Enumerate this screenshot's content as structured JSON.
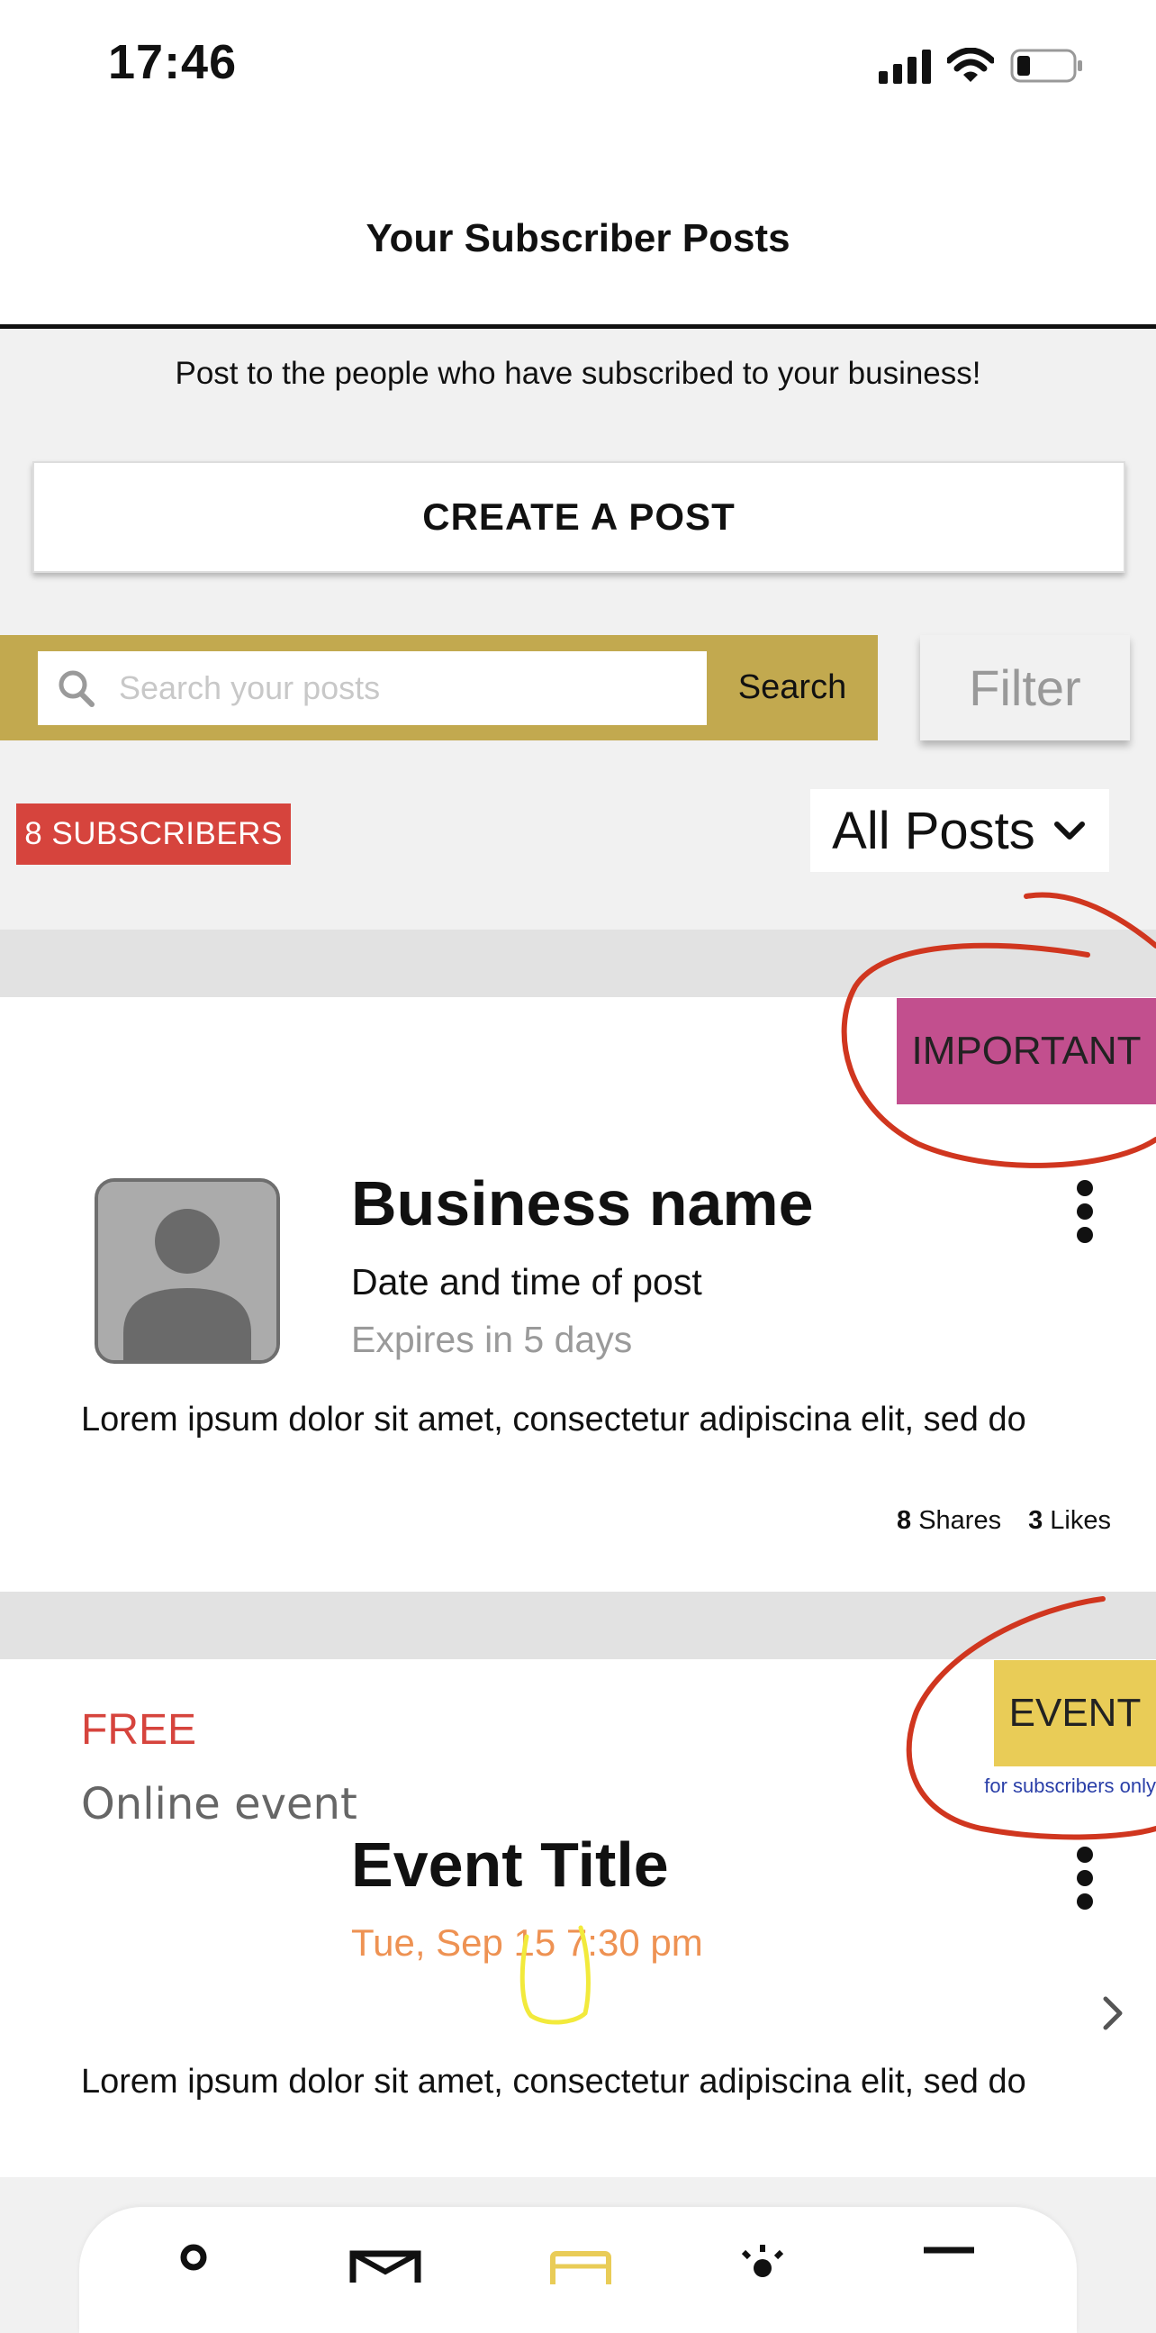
{
  "status_bar": {
    "time": "17:46"
  },
  "header": {
    "title": "Your Subscriber Posts"
  },
  "intro": "Post to the people who have subscribed to your business!",
  "create_post_label": "CREATE A POST",
  "search": {
    "placeholder": "Search your posts",
    "button_label": "Search"
  },
  "filter_label": "Filter",
  "subscribers_badge": "8 SUBSCRIBERS",
  "posts_filter": {
    "selected": "All Posts"
  },
  "posts": [
    {
      "badge": "IMPORTANT",
      "business_name": "Business name",
      "date": "Date and time of post",
      "expires": "Expires in 5 days",
      "body": "Lorem ipsum dolor sit amet, consectetur adipiscina elit, sed do",
      "shares_count": "8",
      "shares_label": "Shares",
      "likes_count": "3",
      "likes_label": "Likes"
    },
    {
      "badge": "EVENT",
      "badge_note": "for subscribers only",
      "price": "FREE",
      "type": "Online event",
      "title": "Event Title",
      "datetime": "Tue, Sep 15 7:30 pm",
      "body": "Lorem ipsum dolor sit amet, consectetur adipiscina elit, sed do"
    }
  ],
  "colors": {
    "gold": "#c2a94f",
    "subscribers_red": "#d6443d",
    "important_pink": "#c24f8e",
    "event_yellow": "#e9cc57",
    "event_date_orange": "#ee9253",
    "annotation_red": "#d0361f",
    "annotation_yellow": "#f2ea3c"
  },
  "icons": {
    "status": [
      "signal-icon",
      "wifi-icon",
      "battery-icon"
    ],
    "search": "search-icon",
    "dropdown": "chevron-down-icon",
    "menu": "more-vertical-icon",
    "next": "chevron-right-icon",
    "nav": [
      "profile-icon",
      "mail-icon",
      "posts-icon",
      "sun-icon",
      "menu-icon"
    ]
  }
}
